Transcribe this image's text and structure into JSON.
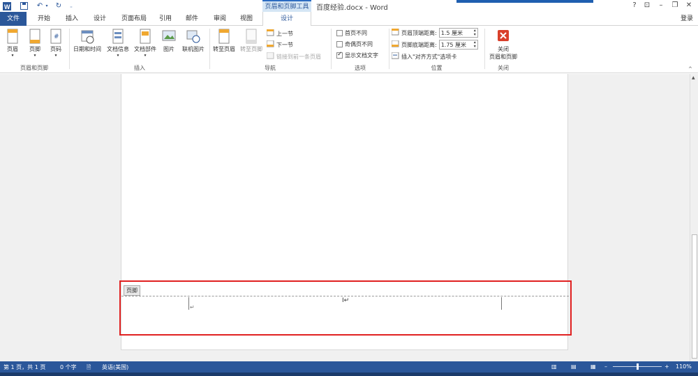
{
  "titlebar": {
    "doc_title": "百度经验.docx - Word",
    "context_group": "页眉和页脚工具",
    "help": "?",
    "login": "登录"
  },
  "tabs": [
    {
      "label": "文件",
      "kind": "file"
    },
    {
      "label": "开始"
    },
    {
      "label": "插入"
    },
    {
      "label": "设计"
    },
    {
      "label": "页面布局"
    },
    {
      "label": "引用"
    },
    {
      "label": "邮件"
    },
    {
      "label": "审阅"
    },
    {
      "label": "视图"
    },
    {
      "label": "设计",
      "kind": "active"
    }
  ],
  "ribbon": {
    "group_header_footer": {
      "label": "页眉和页脚",
      "header_btn": "页眉",
      "footer_btn": "页脚",
      "pagenum_btn": "页码"
    },
    "group_insert": {
      "label": "插入",
      "datetime_btn": "日期和时间",
      "docinfo_btn": "文档信息",
      "quickparts_btn": "文档部件",
      "picture_btn": "图片",
      "onlinepic_btn": "联机图片"
    },
    "group_nav": {
      "label": "导航",
      "goto_header": "转至页眉",
      "goto_footer": "转至页脚",
      "prev_section": "上一节",
      "next_section": "下一节",
      "link_prev": "链接到前一条页眉"
    },
    "group_options": {
      "label": "选项",
      "diff_first": "首页不同",
      "diff_odd_even": "奇偶页不同",
      "show_doc_text": "显示文档文字"
    },
    "group_position": {
      "label": "位置",
      "header_top_label": "页眉顶端距离:",
      "header_top_value": "1.5 厘米",
      "footer_bottom_label": "页脚底端距离:",
      "footer_bottom_value": "1.75 厘米",
      "insert_align_tab": "插入\"对齐方式\"选项卡"
    },
    "group_close": {
      "label": "关闭",
      "close_btn_line1": "关闭",
      "close_btn_line2": "页眉和页脚"
    }
  },
  "document": {
    "footer_tag": "页脚"
  },
  "status": {
    "page": "第 1 页，共 1 页",
    "words": "0 个字",
    "language": "英语(美国)",
    "zoom": "110%"
  },
  "colors": {
    "accent": "#2b579a",
    "highlight": "#e02020"
  }
}
